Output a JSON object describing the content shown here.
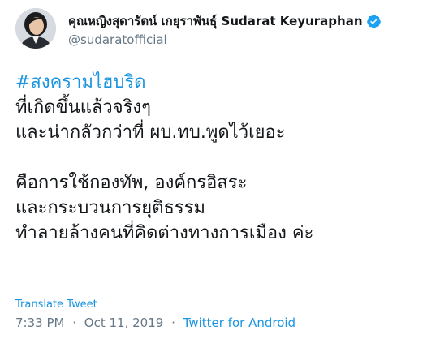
{
  "author": {
    "display_name": "คุณหญิงสุดารัตน์ เกยุราพันธุ์ Sudarat Keyuraphan",
    "handle": "@sudaratofficial",
    "verified": true
  },
  "tweet": {
    "hashtag": "#สงครามไฮบริด",
    "lines": [
      "ที่เกิดขึ้นแล้วจริงๆ",
      "และน่ากลัวกว่าที่ ผบ.ทบ.พูดไว้เยอะ",
      "",
      "คือการใช้กองทัพ, องค์กรอิสระ",
      "และกระบวนการยุติธรรม",
      "ทำลายล้างคนที่คิดต่างทางการเมือง ค่ะ"
    ]
  },
  "translate_label": "Translate Tweet",
  "meta": {
    "time": "7:33 PM",
    "date": "Oct 11, 2019",
    "separator": "·",
    "source": "Twitter for Android"
  },
  "colors": {
    "link": "#1b95e0",
    "text": "#14171a",
    "secondary": "#657786"
  },
  "icons": {
    "verified": "verified-badge-icon",
    "avatar": "avatar-photo"
  }
}
